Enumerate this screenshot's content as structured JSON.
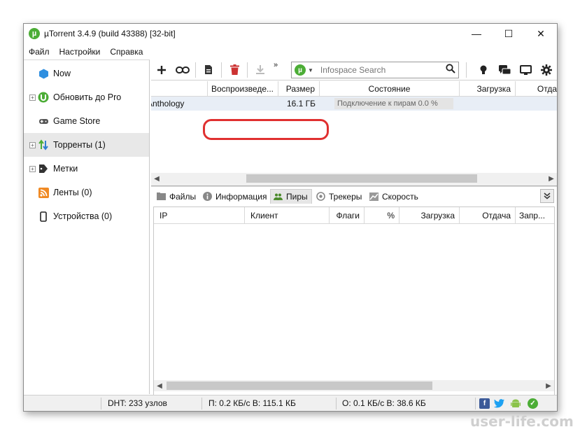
{
  "window": {
    "title": "µTorrent 3.4.9  (build 43388) [32-bit]",
    "logo_letter": "µ",
    "controls": {
      "minimize": "—",
      "maximize": "☐",
      "close": "✕"
    }
  },
  "menu": [
    "Файл",
    "Настройки",
    "Справка"
  ],
  "sidebar": {
    "items": [
      {
        "label": "Now",
        "icon": "now-icon",
        "expander": false,
        "active": false
      },
      {
        "label": "Обновить до Pro",
        "icon": "utorrent-icon",
        "expander": true,
        "active": false
      },
      {
        "label": "Game Store",
        "icon": "gamepad-icon",
        "expander": false,
        "active": false
      },
      {
        "label": "Торренты (1)",
        "icon": "torrents-icon",
        "expander": true,
        "active": true
      },
      {
        "label": "Метки",
        "icon": "tag-icon",
        "expander": true,
        "active": false
      },
      {
        "label": "Ленты (0)",
        "icon": "rss-icon",
        "expander": false,
        "active": false
      },
      {
        "label": "Устройства (0)",
        "icon": "device-icon",
        "expander": false,
        "active": false
      }
    ]
  },
  "toolbar": {
    "icons": [
      "add-icon",
      "link-icon",
      "create-torrent-icon",
      "delete-icon",
      "download-icon",
      "more-icon"
    ],
    "search_placeholder": "Infospace Search",
    "right_icons": [
      "bulb-icon",
      "chat-icon",
      "monitor-icon",
      "settings-icon"
    ]
  },
  "torrent_list": {
    "columns": [
      "Воспроизведе...",
      "Размер",
      "Состояние",
      "Загрузка",
      "Отда"
    ],
    "rows": [
      {
        "name": "Anthology",
        "size": "16.1 ГБ",
        "status": "Подключение к пирам 0.0 %"
      }
    ]
  },
  "tabs": [
    {
      "label": "Файлы",
      "icon": "files-icon",
      "active": false
    },
    {
      "label": "Информация",
      "icon": "info-icon",
      "active": false
    },
    {
      "label": "Пиры",
      "icon": "peers-icon",
      "active": true
    },
    {
      "label": "Трекеры",
      "icon": "trackers-icon",
      "active": false
    },
    {
      "label": "Скорость",
      "icon": "speed-icon",
      "active": false
    }
  ],
  "peers": {
    "columns": [
      "IP",
      "Клиент",
      "Флаги",
      "%",
      "Загрузка",
      "Отдача",
      "Запр..."
    ]
  },
  "status_bar": {
    "dht": "DHT: 233 узлов",
    "download": "П: 0.2 КБ/с В: 115.1 КБ",
    "upload": "О: 0.1 КБ/с В: 38.6 КБ"
  },
  "colors": {
    "accent_green": "#4cad36",
    "highlight_red": "#e03030",
    "row_selected": "#e8eef6"
  },
  "watermark": "user-life.com"
}
